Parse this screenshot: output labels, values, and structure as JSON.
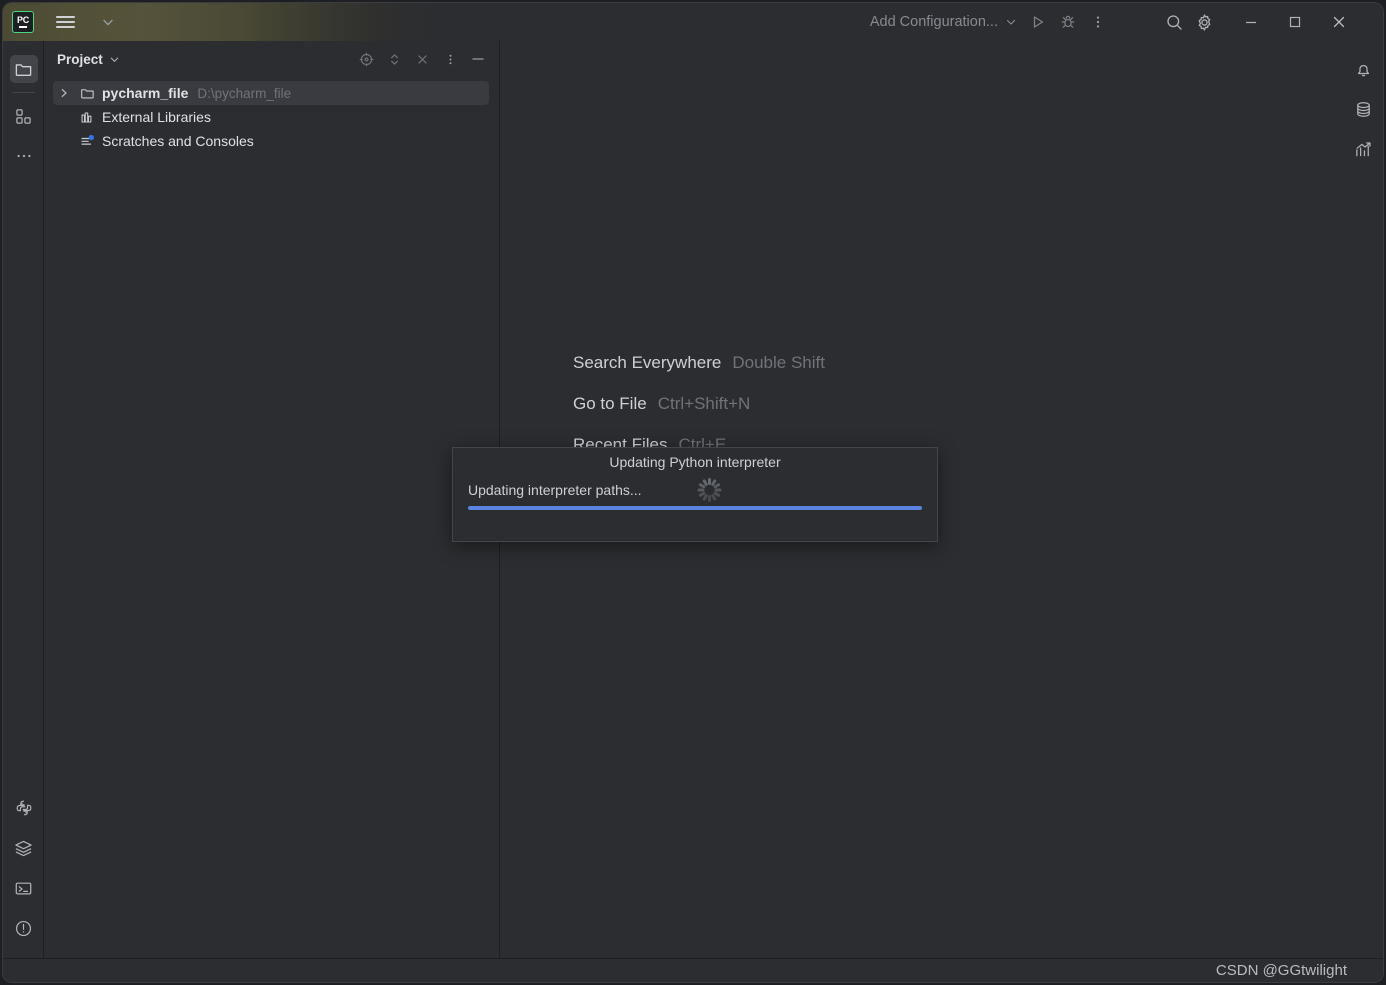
{
  "app": {
    "name": "PyCharm",
    "logo_text": "PC"
  },
  "titlebar": {
    "menu_icon": "hamburger-icon",
    "expand_icon": "chevron-down-icon",
    "run_config_label": "Add Configuration...",
    "run_config_chevron": "chevron-down-icon",
    "run_icon": "run-icon",
    "debug_icon": "debug-icon",
    "more_icon": "more-vertical-icon",
    "search_icon": "search-icon",
    "settings_icon": "gear-icon",
    "minimize_icon": "minimize-icon",
    "maximize_icon": "maximize-icon",
    "close_icon": "close-icon",
    "gradient_start": "#514f36",
    "gradient_end": "#2b2d30"
  },
  "left_strip": {
    "top_items": [
      {
        "name": "project",
        "icon": "folder-icon",
        "active": true
      },
      {
        "name": "structure",
        "icon": "structure-icon",
        "active": false
      },
      {
        "name": "more-tool-windows",
        "icon": "ellipsis-icon",
        "active": false
      }
    ],
    "bottom_items": [
      {
        "name": "python-console",
        "icon": "python-icon",
        "active": false
      },
      {
        "name": "services",
        "icon": "layers-icon",
        "active": false
      },
      {
        "name": "terminal",
        "icon": "terminal-icon",
        "active": false
      },
      {
        "name": "problems",
        "icon": "problems-icon",
        "active": false
      }
    ]
  },
  "right_strip": {
    "items": [
      {
        "name": "notifications",
        "icon": "bell-icon"
      },
      {
        "name": "database",
        "icon": "database-icon"
      },
      {
        "name": "profiler",
        "icon": "chart-icon"
      }
    ]
  },
  "project_panel": {
    "title": "Project",
    "title_chevron": "chevron-down-icon",
    "actions": [
      {
        "name": "select-opened-file",
        "icon": "target-icon"
      },
      {
        "name": "expand-collapse",
        "icon": "updown-arrows-icon"
      },
      {
        "name": "collapse-all",
        "icon": "collapse-all-icon"
      },
      {
        "name": "options",
        "icon": "more-vertical-icon"
      },
      {
        "name": "hide",
        "icon": "minimize-icon"
      }
    ],
    "tree": [
      {
        "label": "pycharm_file",
        "sub": "D:\\pycharm_file",
        "icon": "folder-icon",
        "arrow": "chevron-right-icon",
        "selected": true,
        "bold": true,
        "indent": false
      },
      {
        "label": "External Libraries",
        "sub": "",
        "icon": "library-icon",
        "arrow": "",
        "selected": false,
        "bold": false,
        "indent": true
      },
      {
        "label": "Scratches and Consoles",
        "sub": "",
        "icon": "scratches-icon",
        "arrow": "",
        "selected": false,
        "bold": false,
        "indent": true
      }
    ]
  },
  "editor": {
    "tips": [
      {
        "name": "Search Everywhere",
        "key": "Double Shift"
      },
      {
        "name": "Go to File",
        "key": "Ctrl+Shift+N"
      },
      {
        "name": "Recent Files",
        "key": "Ctrl+E"
      }
    ]
  },
  "modal": {
    "title": "Updating Python interpreter",
    "message": "Updating interpreter paths...",
    "spinner_icon": "loading-spinner-icon",
    "progress_percent": 100,
    "progress_color": "#5b84e0",
    "track_color": "#3b5fa8"
  },
  "statusbar": {
    "watermark": "CSDN @GGtwilight"
  },
  "colors": {
    "background": "#2b2d30",
    "window_border": "#1e1f22",
    "text_primary": "#dfe1e5",
    "text_secondary": "#6f737a",
    "selection": "#393b40",
    "accent_green": "#3ddc84",
    "accent_blue": "#5b84e0"
  }
}
